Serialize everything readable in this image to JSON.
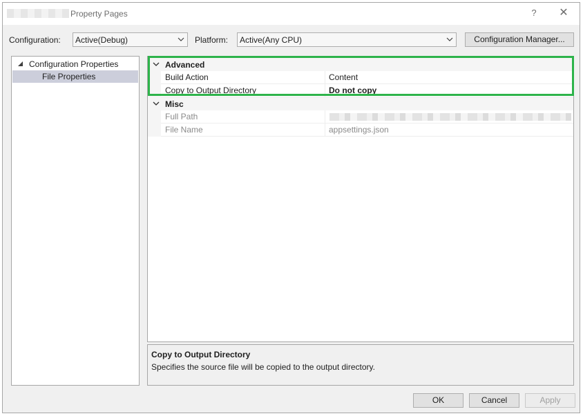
{
  "window": {
    "title": "Property Pages",
    "help_glyph": "?",
    "close_glyph": "✕"
  },
  "toolbar": {
    "configuration_label": "Configuration:",
    "configuration_value": "Active(Debug)",
    "platform_label": "Platform:",
    "platform_value": "Active(Any CPU)",
    "config_manager_label": "Configuration Manager..."
  },
  "tree": {
    "items": [
      {
        "label": "Configuration Properties",
        "expanded": true
      },
      {
        "label": "File Properties",
        "selected": true
      }
    ]
  },
  "grid": {
    "categories": [
      {
        "label": "Advanced",
        "properties": [
          {
            "name": "Build Action",
            "value": "Content",
            "bold": false,
            "readonly": false
          },
          {
            "name": "Copy to Output Directory",
            "value": "Do not copy",
            "bold": true,
            "readonly": false
          }
        ]
      },
      {
        "label": "Misc",
        "properties": [
          {
            "name": "Full Path",
            "value": "",
            "readonly": true
          },
          {
            "name": "File Name",
            "value": "appsettings.json",
            "readonly": true
          }
        ]
      }
    ]
  },
  "description": {
    "title": "Copy to Output Directory",
    "text": "Specifies the source file will be copied to the output directory."
  },
  "buttons": {
    "ok": "OK",
    "cancel": "Cancel",
    "apply": "Apply"
  },
  "colors": {
    "highlight": "#2db34a",
    "selection": "#cccedb"
  }
}
